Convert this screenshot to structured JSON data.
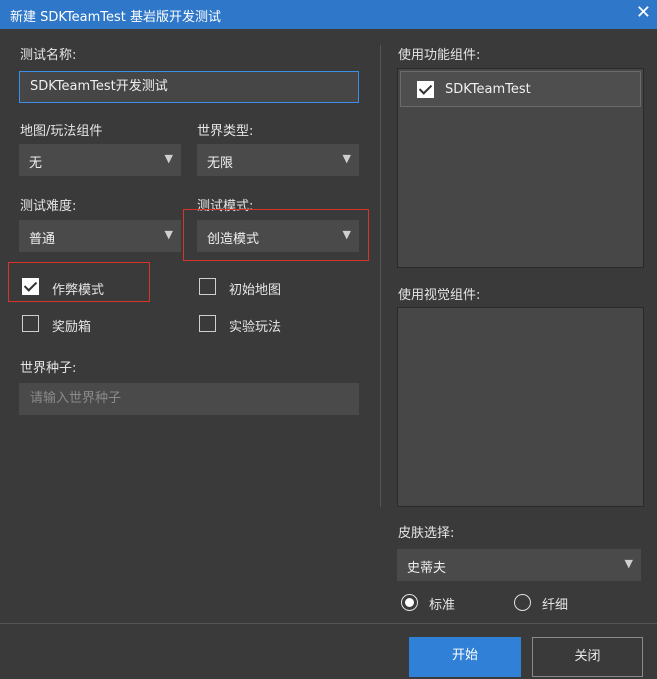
{
  "window": {
    "title": "新建 SDKTeamTest 基岩版开发测试",
    "close_glyph": "✕"
  },
  "left": {
    "test_name": {
      "label": "测试名称:",
      "value": "SDKTeamTest开发测试"
    },
    "map_addon": {
      "label": "地图/玩法组件",
      "value": "无"
    },
    "world_type": {
      "label": "世界类型:",
      "value": "无限"
    },
    "difficulty": {
      "label": "测试难度:",
      "value": "普通"
    },
    "test_mode": {
      "label": "测试模式:",
      "value": "创造模式"
    },
    "options": {
      "cheat_mode": {
        "label": "作弊模式",
        "checked": true
      },
      "initial_map": {
        "label": "初始地图",
        "checked": false
      },
      "bonus_chest": {
        "label": "奖励箱",
        "checked": false
      },
      "experimental": {
        "label": "实验玩法",
        "checked": false
      }
    },
    "seed": {
      "label": "世界种子:",
      "placeholder": "请输入世界种子"
    }
  },
  "right": {
    "functional_label": "使用功能组件:",
    "functional_items": [
      {
        "label": "SDKTeamTest",
        "checked": true
      }
    ],
    "visual_label": "使用视觉组件:",
    "skin": {
      "label": "皮肤选择:",
      "value": "史蒂夫",
      "radio_standard": "标准",
      "radio_slim": "纤细",
      "selected": "标准"
    }
  },
  "buttons": {
    "start": "开始",
    "close": "关闭"
  },
  "colors": {
    "accent": "#2f80d6",
    "titlebar": "#2f77c9",
    "highlight": "#d9342b",
    "background": "#3a3a3a"
  }
}
